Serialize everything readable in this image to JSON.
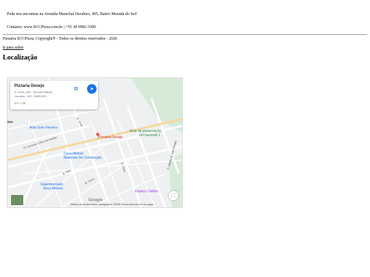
{
  "footer": {
    "address": "Pode nos encontrar na Avenida Marechal Deodoro, 905, Bairro Morada do Sol!",
    "contacts": "Contatos: www.SCCPizza.com.br | +55 38 9982-3300",
    "copyright": "Pizzaria SCCPizza, Copyright® - Todos os direitos reservados - 2026",
    "about_link": "Ir para sobre"
  },
  "location": {
    "heading": "Localização"
  },
  "map": {
    "card": {
      "name": "Pizzaria Desejo",
      "address_line1": "R. Onze, 405 - Terceiro Milênio,",
      "address_line2": "Januária - MG, 39480-000",
      "rating": "4.5",
      "rating_count": "(6)"
    },
    "labels": {
      "pin": "Pizzaria Desejo",
      "auto": "Auto Som Ferreira",
      "casa": "Casa Milênio",
      "casa2": "Materiais De Construção",
      "mercado": "Supermercado",
      "mercado2": "Novo Milênio",
      "preservacao": "Área de preservação",
      "preservacao2": "permanente 1",
      "espaco": "Espaço Caldas",
      "corredor": "R. Corredor Chico de Abelão",
      "onze": "R. Onze",
      "seis": "R. Seis",
      "cinco": "R. Cinco",
      "vinte": "R. Vinte",
      "vinte2": "R. Vinte e Um",
      "barao": "R. Barão de São Romão",
      "tion": "tion",
      "google": "Google",
      "attribution": "Atalhos do teclado   Dados cartográficos ©2026   Termos   Informar erro no mapa"
    },
    "icons": [
      "external-link-icon",
      "directions-icon",
      "location-pin-icon",
      "fullscreen-icon"
    ],
    "colors": {
      "pin": "#d93025",
      "poi_blue": "#1a73e8",
      "park": "#c8e6c9"
    }
  }
}
